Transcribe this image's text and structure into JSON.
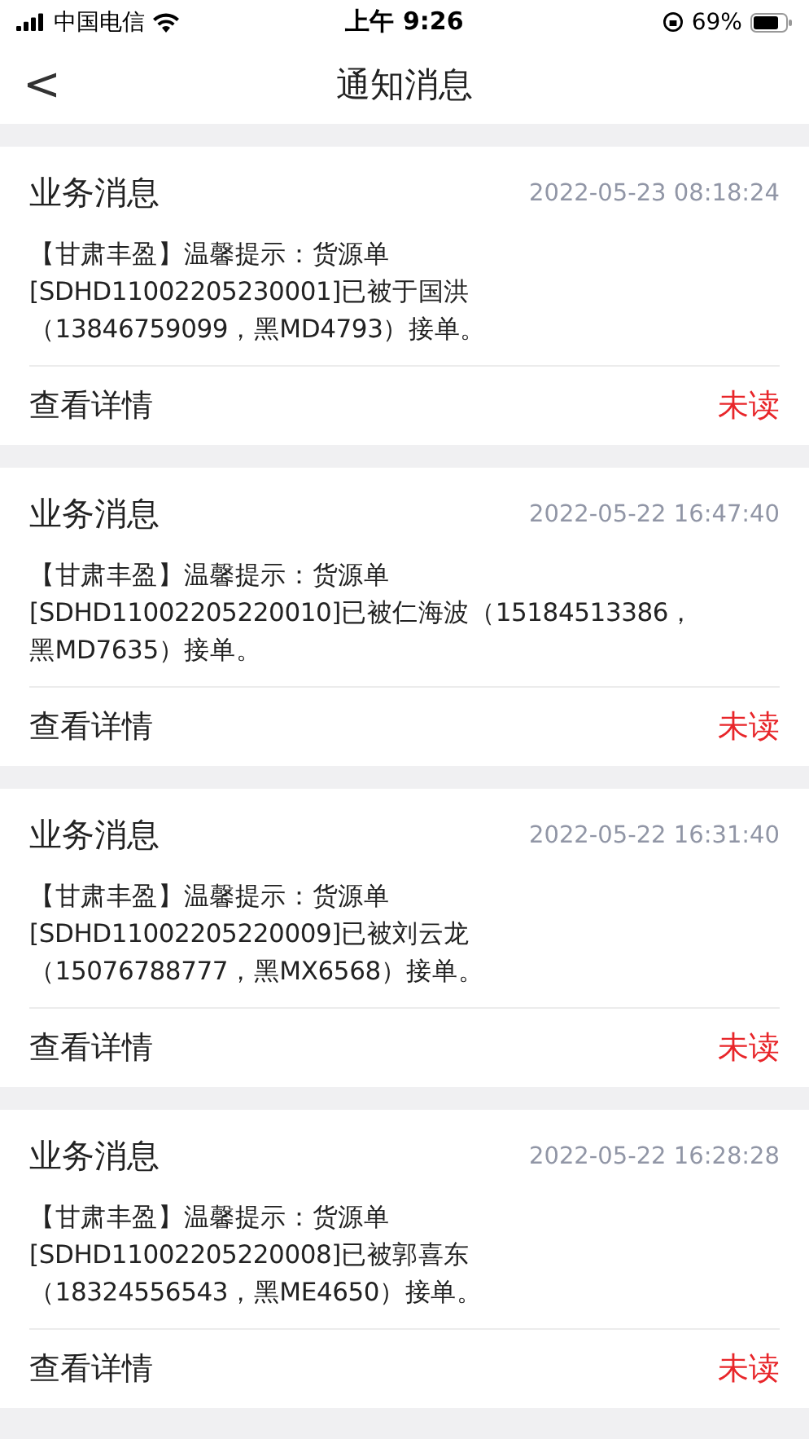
{
  "status_bar": {
    "carrier": "中国电信",
    "time": "上午 9:26",
    "battery": "69%"
  },
  "nav": {
    "back": "<",
    "title": "通知消息"
  },
  "messages": [
    {
      "category": "业务消息",
      "time": "2022-05-23 08:18:24",
      "lines": [
        "【甘肃丰盈】温馨提示：货源单",
        "[SDHD11002205230001]已被于国洪",
        "（13846759099，黑MD4793）接单。"
      ],
      "action": "查看详情",
      "status": "未读",
      "read": false
    },
    {
      "category": "业务消息",
      "time": "2022-05-22 16:47:40",
      "lines": [
        "【甘肃丰盈】温馨提示：货源单",
        "[SDHD11002205220010]已被仁海波（15184513386，",
        "黑MD7635）接单。"
      ],
      "action": "查看详情",
      "status": "未读",
      "read": false
    },
    {
      "category": "业务消息",
      "time": "2022-05-22 16:31:40",
      "lines": [
        "【甘肃丰盈】温馨提示：货源单",
        "[SDHD11002205220009]已被刘云龙",
        "（15076788777，黑MX6568）接单。"
      ],
      "action": "查看详情",
      "status": "未读",
      "read": false
    },
    {
      "category": "业务消息",
      "time": "2022-05-22 16:28:28",
      "lines": [
        "【甘肃丰盈】温馨提示：货源单",
        "[SDHD11002205220008]已被郭喜东",
        "（18324556543，黑ME4650）接单。"
      ],
      "action": "查看详情",
      "status": "未读",
      "read": false
    }
  ]
}
